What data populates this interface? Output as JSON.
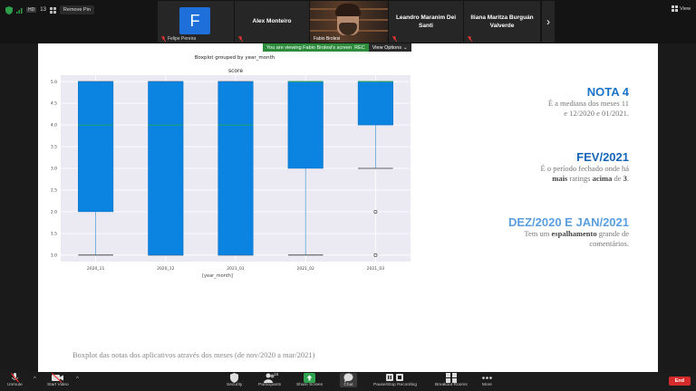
{
  "topbar": {
    "view_menu_icon": "security-shield-icon",
    "hd_badge": "HD",
    "meeting_number": "13",
    "remove_pin": "Remove Pin",
    "view_label": "View",
    "participants": [
      {
        "display": "F",
        "name": "Felipe Pereira"
      },
      {
        "display": "",
        "name": "Alex Monteiro"
      },
      {
        "display": "video",
        "name": "Fabio Brolesi"
      },
      {
        "display": "",
        "name": "Leandro Maranim Dei Santi"
      },
      {
        "display": "",
        "name": "Iliana Maritza Burguán Valverde"
      }
    ]
  },
  "banner": {
    "viewing": "You are viewing Fabio Brolesi's screen",
    "rec": "REC",
    "view_options": "View Options"
  },
  "slide": {
    "caption": "Boxplot das notas dos aplicativos através dos meses (de nov/2020 a mar/2021)",
    "notes": [
      {
        "title": "NOTA 4",
        "line1": "É a mediana dos meses 11",
        "line2": "e 12/2020 e 01/2021.",
        "line2_bold": ""
      },
      {
        "title": "FEV/2021",
        "line1": "É o período fechado onde há",
        "line2_pre": "",
        "line2_b1": "mais",
        "line2_m1": " ratings ",
        "line2_b2": "acima",
        "line2_m2": " de ",
        "line2_b3": "3",
        "line2_end": "."
      },
      {
        "title": "DEZ/2020 E JAN/2021",
        "line1_pre": "Tem um ",
        "line1_b": "espalhamento",
        "line1_post": " grande de",
        "line2": "comentários."
      }
    ]
  },
  "chart_data": {
    "type": "boxplot",
    "suptitle": "Boxplot grouped by year_month",
    "title": "score",
    "xlabel": "[year_month]",
    "ylabel": "",
    "ylim": [
      0.85,
      5.15
    ],
    "yticks": [
      1.0,
      1.5,
      2.0,
      2.5,
      3.0,
      3.5,
      4.0,
      4.5,
      5.0
    ],
    "ytick_labels": [
      "1.0",
      "1.5",
      "2.0",
      "2.5",
      "3.0",
      "3.5",
      "4.0",
      "4.5",
      "5.0"
    ],
    "grid": true,
    "categories": [
      "2020_11",
      "2020_12",
      "2021_01",
      "2021_02",
      "2021_03"
    ],
    "boxes": [
      {
        "whisker_low": 1.0,
        "q1": 2.0,
        "median": 4.0,
        "q3": 5.0,
        "whisker_high": 5.0,
        "outliers": []
      },
      {
        "whisker_low": 1.0,
        "q1": 1.0,
        "median": 4.0,
        "q3": 5.0,
        "whisker_high": 5.0,
        "outliers": []
      },
      {
        "whisker_low": 1.0,
        "q1": 1.0,
        "median": 4.0,
        "q3": 5.0,
        "whisker_high": 5.0,
        "outliers": []
      },
      {
        "whisker_low": 1.0,
        "q1": 3.0,
        "median": 5.0,
        "q3": 5.0,
        "whisker_high": 5.0,
        "outliers": []
      },
      {
        "whisker_low": 3.0,
        "q1": 4.0,
        "median": 5.0,
        "q3": 5.0,
        "whisker_high": 5.0,
        "outliers": [
          2.0,
          1.0
        ]
      }
    ],
    "colors": {
      "box": "#0a84e0",
      "median": "#22aa44",
      "whisker": "#5aa0d8",
      "background": "#ebeaf2",
      "grid": "#ffffff"
    }
  },
  "toolbar": {
    "unmute": "Unmute",
    "start_video": "Start Video",
    "security": "Security",
    "participants": "Participants",
    "participants_count": "15",
    "share_screen": "Share Screen",
    "chat": "Chat",
    "pause_recording": "Pause/Stop Recording",
    "breakout_rooms": "Breakout Rooms",
    "more": "More",
    "end": "End"
  }
}
